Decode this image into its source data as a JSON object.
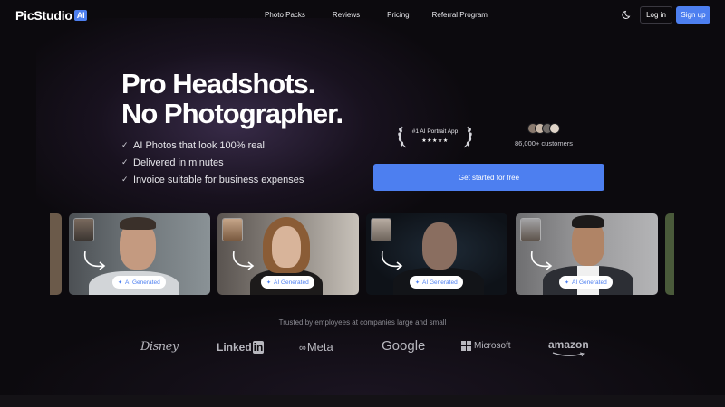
{
  "nav": {
    "logo_text": "PicStudio",
    "logo_badge": "AI",
    "links": [
      "Photo Packs",
      "Reviews",
      "Pricing",
      "Referral Program"
    ],
    "login_label": "Log in",
    "signup_label": "Sign up"
  },
  "hero": {
    "title_line1": "Pro Headshots.",
    "title_line2": "No Photographer.",
    "features": [
      "AI Photos that look 100% real",
      "Delivered in minutes",
      "Invoice suitable for business expenses"
    ],
    "award_text": "#1 AI Portrait App",
    "award_stars": "★★★★★",
    "customers_text": "86,000+ customers",
    "cta_label": "Get started for free"
  },
  "gallery": {
    "badge_label": "AI Generated",
    "cards_count": 4
  },
  "trusted": {
    "text": "Trusted by employees at companies large and small",
    "logos": [
      "Disney",
      "Linked",
      "in",
      "Meta",
      "Google",
      "Microsoft",
      "amazon"
    ]
  },
  "colors": {
    "accent": "#4d7ff0",
    "background": "#0c0a0e"
  }
}
